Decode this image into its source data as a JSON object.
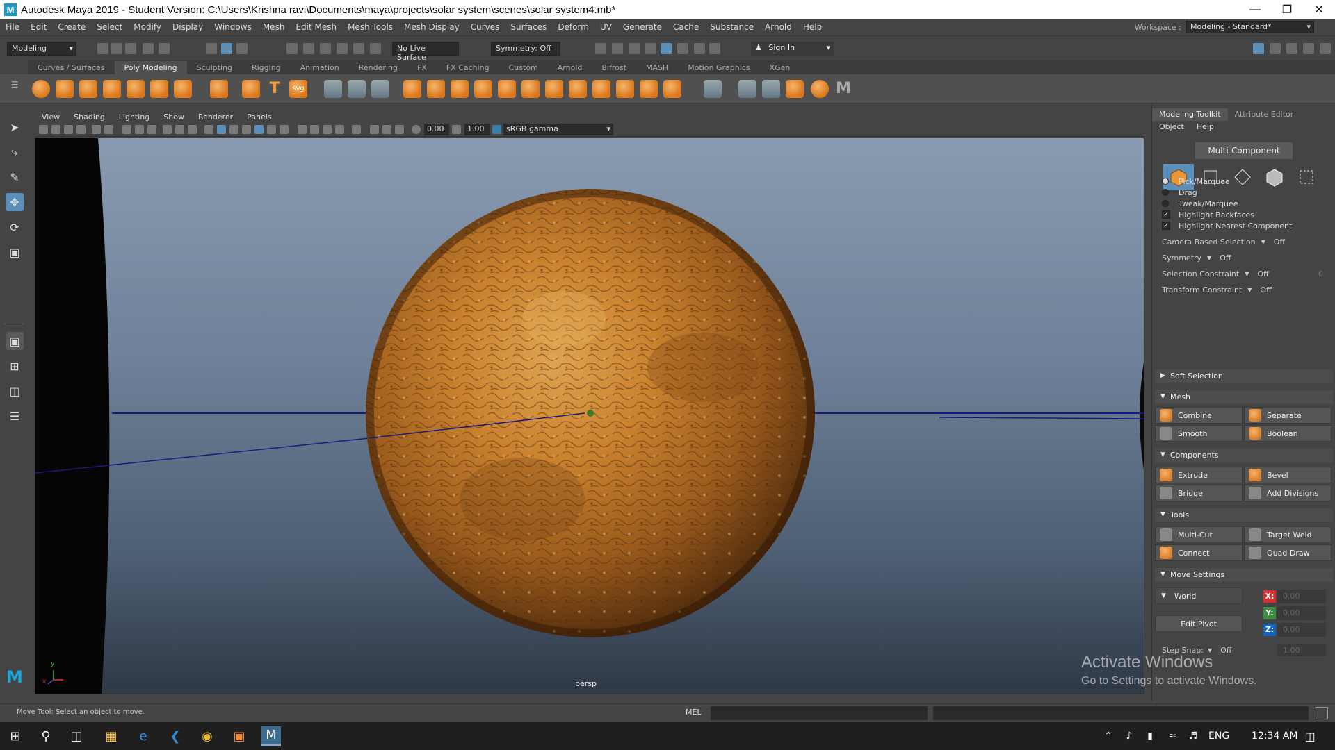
{
  "window": {
    "title": "Autodesk Maya 2019 - Student Version: C:\\Users\\Krishna ravi\\Documents\\maya\\projects\\solar system\\scenes\\solar system4.mb*",
    "logo_letter": "M"
  },
  "menu": [
    "File",
    "Edit",
    "Create",
    "Select",
    "Modify",
    "Display",
    "Windows",
    "Mesh",
    "Edit Mesh",
    "Mesh Tools",
    "Mesh Display",
    "Curves",
    "Surfaces",
    "Deform",
    "UV",
    "Generate",
    "Cache",
    "Substance",
    "Arnold",
    "Help"
  ],
  "workspace": {
    "label": "Workspace :",
    "value": "Modeling - Standard*"
  },
  "statusline": {
    "mode": "Modeling",
    "live_surface": "No Live Surface",
    "symmetry": "Symmetry: Off",
    "sign_in": "Sign In"
  },
  "shelf_tabs": [
    "Curves / Surfaces",
    "Poly Modeling",
    "Sculpting",
    "Rigging",
    "Animation",
    "Rendering",
    "FX",
    "FX Caching",
    "Custom",
    "Arnold",
    "Bifrost",
    "MASH",
    "Motion Graphics",
    "XGen"
  ],
  "shelf_active": "Poly Modeling",
  "shelf_text_icons": {
    "type": "T",
    "svg": "svg"
  },
  "viewport": {
    "menu": [
      "View",
      "Shading",
      "Lighting",
      "Show",
      "Renderer",
      "Panels"
    ],
    "exposure": "0.00",
    "gamma": "1.00",
    "color_space": "sRGB gamma",
    "camera_label": "persp",
    "axis_y": "y",
    "axis_x": "x"
  },
  "right_panel": {
    "tabs": [
      "Modeling Toolkit",
      "Attribute Editor"
    ],
    "menu": [
      "Object",
      "Help"
    ],
    "multi_component": "Multi-Component",
    "selection_options": [
      {
        "label": "Pick/Marquee",
        "kind": "radio",
        "on": true
      },
      {
        "label": "Drag",
        "kind": "radio",
        "on": false
      },
      {
        "label": "Tweak/Marquee",
        "kind": "radio",
        "on": false
      },
      {
        "label": "Highlight Backfaces",
        "kind": "check",
        "on": true
      },
      {
        "label": "Highlight Nearest Component",
        "kind": "check",
        "on": true
      }
    ],
    "props": [
      {
        "label": "Camera Based Selection",
        "value": "Off"
      },
      {
        "label": "Symmetry",
        "value": "Off"
      },
      {
        "label": "Selection Constraint",
        "value": "Off",
        "extra": "0"
      },
      {
        "label": "Transform Constraint",
        "value": "Off"
      }
    ],
    "sections": {
      "soft_selection": "Soft Selection",
      "mesh": "Mesh",
      "components": "Components",
      "tools": "Tools",
      "move_settings": "Move Settings"
    },
    "mesh_buttons": [
      "Combine",
      "Separate",
      "Smooth",
      "Boolean"
    ],
    "component_buttons": [
      "Extrude",
      "Bevel",
      "Bridge",
      "Add Divisions"
    ],
    "tool_buttons": [
      "Multi-Cut",
      "Target Weld",
      "Connect",
      "Quad Draw"
    ],
    "move": {
      "space": "World",
      "edit_pivot": "Edit Pivot",
      "x_label": "X:",
      "y_label": "Y:",
      "z_label": "Z:",
      "x": "0.00",
      "y": "0.00",
      "z": "0.00",
      "step_snap_label": "Step Snap:",
      "step_snap": "Off",
      "step_value": "1.00"
    }
  },
  "helpline": {
    "text": "Move Tool: Select an object to move.",
    "mel": "MEL"
  },
  "watermark": {
    "title": "Activate Windows",
    "sub": "Go to Settings to activate Windows."
  },
  "taskbar": {
    "lang": "ENG",
    "time": "12:34 AM"
  },
  "colors": {
    "accent": "#5b8fb9",
    "planet": "#c77a2a",
    "titlebar": "#ffffff"
  }
}
